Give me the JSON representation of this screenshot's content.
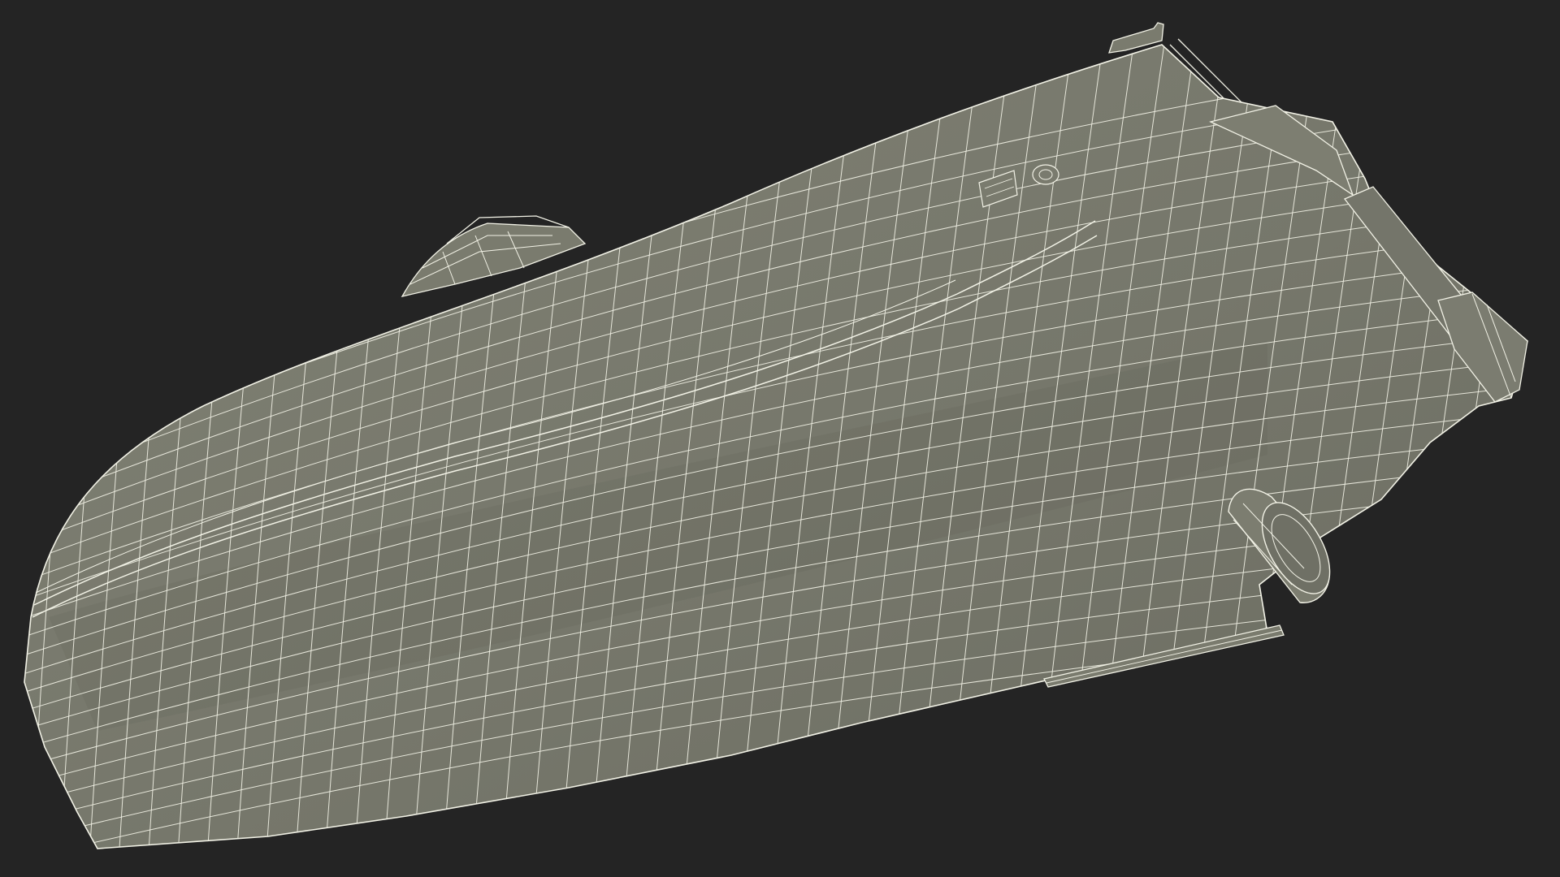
{
  "scene": {
    "subject": "boat-hull-wireframe",
    "colors": {
      "background": "#242424",
      "hull_fill": "#7a7b6e",
      "hull_shadow": "#696a5f",
      "wire": "#f2f2e6"
    }
  }
}
